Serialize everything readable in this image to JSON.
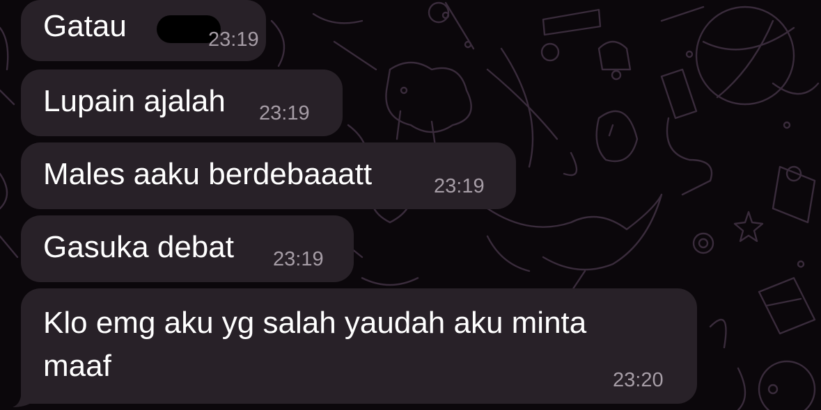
{
  "chat": {
    "messages": [
      {
        "text": "Gatau",
        "time": "23:19"
      },
      {
        "text": "Lupain ajalah",
        "time": "23:19"
      },
      {
        "text": "Males aaku berdebaaatt",
        "time": "23:19"
      },
      {
        "text": "Gasuka debat",
        "time": "23:19"
      },
      {
        "text_line1": "Klo emg aku yg salah yaudah aku minta",
        "text_line2": "maaf",
        "time": "23:20"
      }
    ]
  },
  "colors": {
    "background": "#0b070b",
    "bubble": "#282128",
    "text": "#ffffff",
    "timestamp": "#a79ea7",
    "wallpaper_doodle": "#3a2c3c"
  }
}
